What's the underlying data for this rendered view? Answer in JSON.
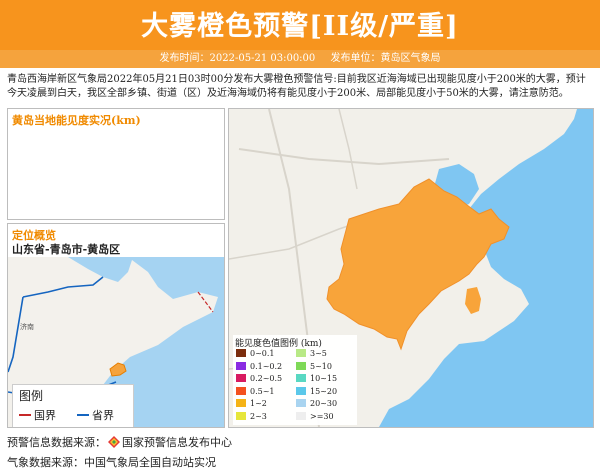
{
  "header": {
    "title": "大雾橙色预警[II级/严重]",
    "publish_label": "发布时间：2022-05-21 03:00:00",
    "unit_label": "发布单位：黄岛区气象局"
  },
  "description": "青岛西海岸新区气象局2022年05月21日03时00分发布大雾橙色预警信号:目前我区近海海域已出现能见度小于200米的大雾，预计今天凌晨到白天，我区全部乡镇、街道（区）及近海海域仍将有能见度小于200米、局部能见度小于50米的大雾，请注意防范。",
  "visibility_panel": {
    "title": "黄岛当地能见度实况(km)"
  },
  "location_panel": {
    "title": "定位概览",
    "subtitle": "山东省-青岛市-黄岛区",
    "legend": {
      "title": "图例",
      "country": "国界",
      "province": "省界"
    },
    "labels": {
      "jinan": "济南"
    }
  },
  "map_legend": {
    "title": "能见度色值图例 (km)",
    "left": [
      {
        "label": "0~0.1",
        "color": "#7b2d0d"
      },
      {
        "label": "0.1~0.2",
        "color": "#8a2be2"
      },
      {
        "label": "0.2~0.5",
        "color": "#d81b60"
      },
      {
        "label": "0.5~1",
        "color": "#f4511e"
      },
      {
        "label": "1~2",
        "color": "#f5b316"
      },
      {
        "label": "2~3",
        "color": "#e6e63a"
      }
    ],
    "right": [
      {
        "label": "3~5",
        "color": "#b8e986"
      },
      {
        "label": "5~10",
        "color": "#7ed957"
      },
      {
        "label": "10~15",
        "color": "#59d8c2"
      },
      {
        "label": "15~20",
        "color": "#5bc8ea"
      },
      {
        "label": "20~30",
        "color": "#a9d4f0"
      },
      {
        "label": ">=30",
        "color": "#eeeeee"
      }
    ]
  },
  "footer": {
    "line1_prefix": "预警信息数据来源：",
    "line1_source": "国家预警信息发布中心",
    "line2": "气象数据来源：中国气象局全国自动站实况"
  },
  "colors": {
    "alert": "#f7941d",
    "fog_area": "#f8a43a",
    "sea": "#7fc6f2"
  }
}
